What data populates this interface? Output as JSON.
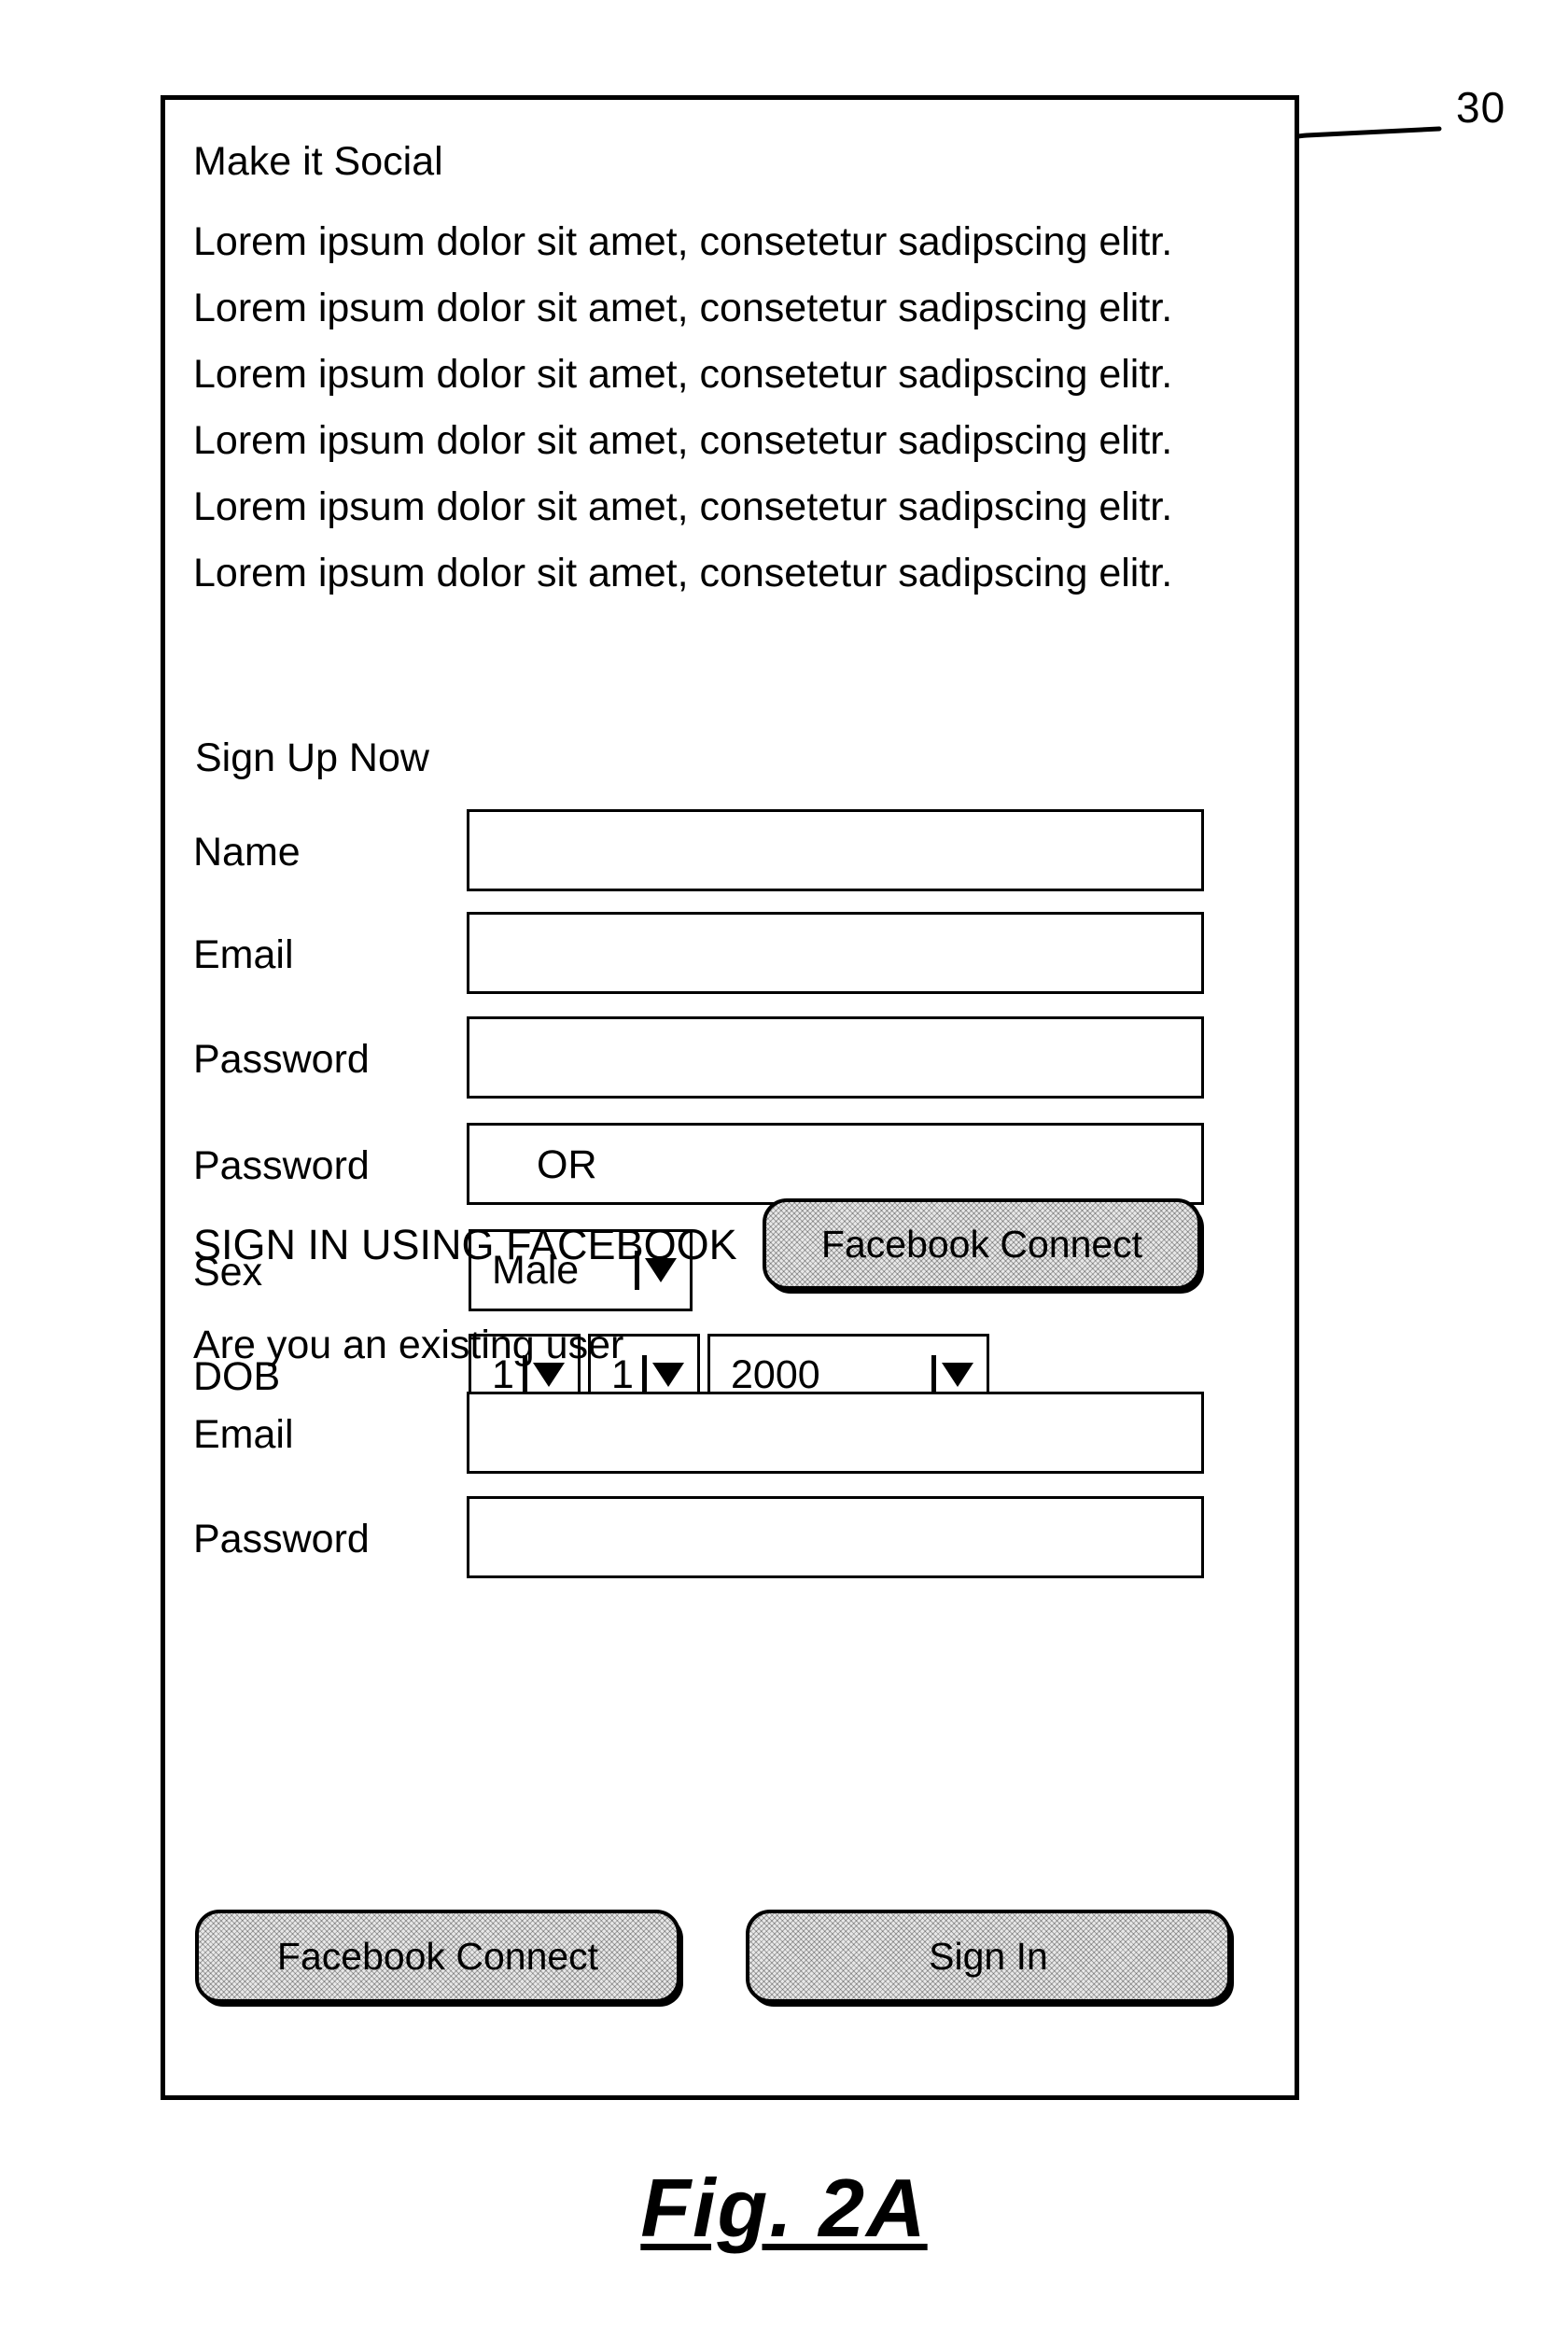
{
  "figure": {
    "caption": "Fig. 2A",
    "reference_numeral": "30"
  },
  "screen": {
    "heading": "Make it Social",
    "body_paragraph": "Lorem ipsum dolor sit amet, consetetur sadipscing elitr. Lorem ipsum dolor sit amet, consetetur sadipscing elitr. Lorem ipsum dolor sit amet, consetetur sadipscing elitr. Lorem ipsum dolor sit amet, consetetur sadipscing elitr. Lorem ipsum dolor sit amet, consetetur sadipscing elitr. Lorem ipsum dolor sit amet, consetetur sadipscing elitr.",
    "signup": {
      "heading": "Sign Up Now",
      "fields": [
        {
          "label": "Name",
          "value": ""
        },
        {
          "label": "Email",
          "value": ""
        },
        {
          "label": "Password",
          "value": ""
        },
        {
          "label": "Password",
          "value": ""
        }
      ],
      "sex": {
        "label": "Sex",
        "value": "Male"
      },
      "dob": {
        "label": "DOB",
        "day": "1",
        "month": "1",
        "year": "2000"
      }
    },
    "or_separator": "OR",
    "facebook_signin": {
      "label": "SIGN IN USING FACEBOOK",
      "button_label": "Facebook Connect"
    },
    "existing_user": {
      "heading": "Are you an existing user",
      "fields": [
        {
          "label": "Email",
          "value": ""
        },
        {
          "label": "Password",
          "value": ""
        }
      ],
      "facebook_button_label": "Facebook Connect",
      "signin_button_label": "Sign In"
    }
  },
  "icons": {
    "dropdown_arrow": "chevron-down-icon",
    "dropdown_divider": "separator-bar-icon"
  },
  "colors": {
    "line": "#000000",
    "background": "#ffffff",
    "button_fill": "#e8e8e8"
  }
}
